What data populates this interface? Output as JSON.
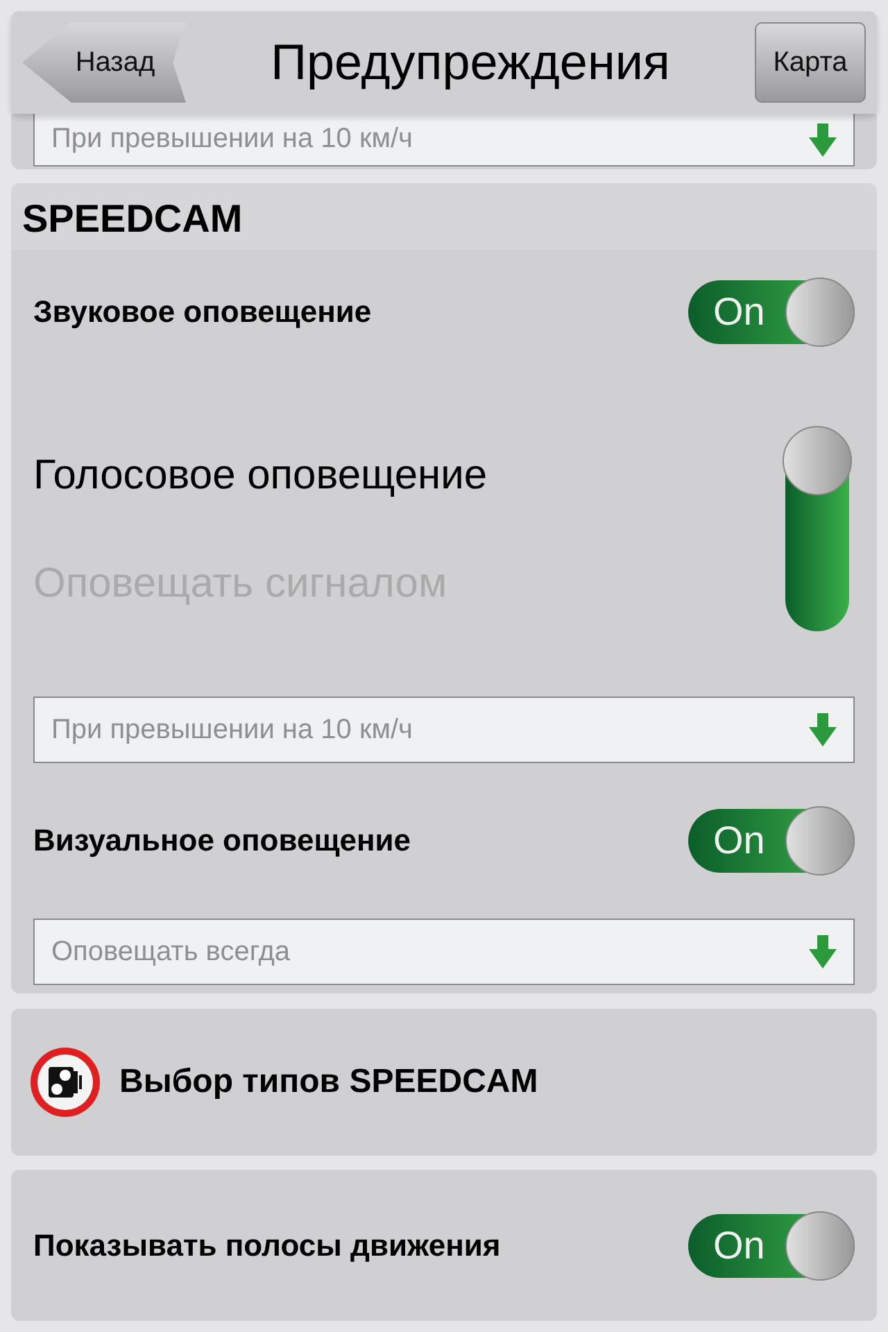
{
  "header": {
    "back": "Назад",
    "title": "Предупреждения",
    "map": "Карта"
  },
  "top_dropdown": {
    "value": "При превышении на 10 км/ч"
  },
  "section": {
    "title": "SPEEDCAM",
    "items": [
      {
        "kind": "toggle",
        "label": "Звуковое оповещение",
        "on": true,
        "state_text": "On"
      },
      {
        "kind": "choice",
        "options": [
          {
            "label": "Голосовое оповещение",
            "selected": true
          },
          {
            "label": "Оповещать сигналом",
            "selected": false
          }
        ]
      },
      {
        "kind": "dropdown",
        "value": "При превышении на 10 км/ч"
      },
      {
        "kind": "toggle",
        "label": "Визуальное оповещение",
        "on": true,
        "state_text": "On"
      },
      {
        "kind": "dropdown",
        "value": "Оповещать всегда"
      }
    ]
  },
  "speedcam_types": {
    "label": "Выбор типов SPEEDCAM"
  },
  "lanes": {
    "label": "Показывать полосы движения",
    "on": true,
    "state_text": "On"
  }
}
